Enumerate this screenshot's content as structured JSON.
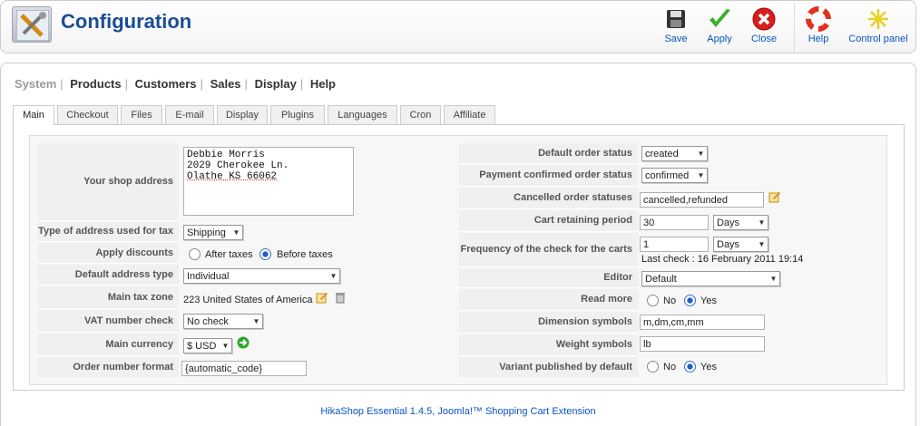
{
  "header": {
    "title": "Configuration",
    "toolbar": {
      "save": "Save",
      "apply": "Apply",
      "close": "Close",
      "help": "Help",
      "control_panel": "Control panel"
    }
  },
  "menu": [
    "System",
    "Products",
    "Customers",
    "Sales",
    "Display",
    "Help"
  ],
  "tabs": [
    "Main",
    "Checkout",
    "Files",
    "E-mail",
    "Display",
    "Plugins",
    "Languages",
    "Cron",
    "Affiliate"
  ],
  "left": {
    "shop_address_label": "Your shop address",
    "shop_address_lines": [
      "Debbie Morris",
      "2029 Cherokee Ln.",
      "Olathe KS 66062"
    ],
    "address_type_label": "Type of address used for tax",
    "address_type_value": "Shipping",
    "apply_discounts_label": "Apply discounts",
    "discount_after": "After taxes",
    "discount_before": "Before taxes",
    "default_address_type_label": "Default address type",
    "default_address_type_value": "Individual",
    "main_tax_zone_label": "Main tax zone",
    "main_tax_zone_value": "223 United States of America",
    "vat_check_label": "VAT number check",
    "vat_check_value": "No check",
    "main_currency_label": "Main currency",
    "main_currency_value": "$ USD",
    "order_number_format_label": "Order number format",
    "order_number_format_value": "{automatic_code}"
  },
  "right": {
    "default_order_status_label": "Default order status",
    "default_order_status_value": "created",
    "payment_confirmed_label": "Payment confirmed order status",
    "payment_confirmed_value": "confirmed",
    "cancelled_label": "Cancelled order statuses",
    "cancelled_value": "cancelled,refunded",
    "cart_retaining_label": "Cart retaining period",
    "cart_retaining_value": "30",
    "cart_retaining_unit": "Days",
    "frequency_label": "Frequency of the check for the carts",
    "frequency_value": "1",
    "frequency_unit": "Days",
    "last_check": "Last check : 16 February 2011 19:14",
    "editor_label": "Editor",
    "editor_value": "Default",
    "read_more_label": "Read more",
    "read_more_no": "No",
    "read_more_yes": "Yes",
    "dimension_label": "Dimension symbols",
    "dimension_value": "m,dm,cm,mm",
    "weight_label": "Weight symbols",
    "weight_value": "lb",
    "variant_label": "Variant published by default",
    "variant_no": "No",
    "variant_yes": "Yes"
  },
  "footer": "HikaShop Essential 1.4.5, Joomla!™ Shopping Cart Extension",
  "colors": {
    "link": "#0b55c4",
    "title": "#1a4d94"
  }
}
